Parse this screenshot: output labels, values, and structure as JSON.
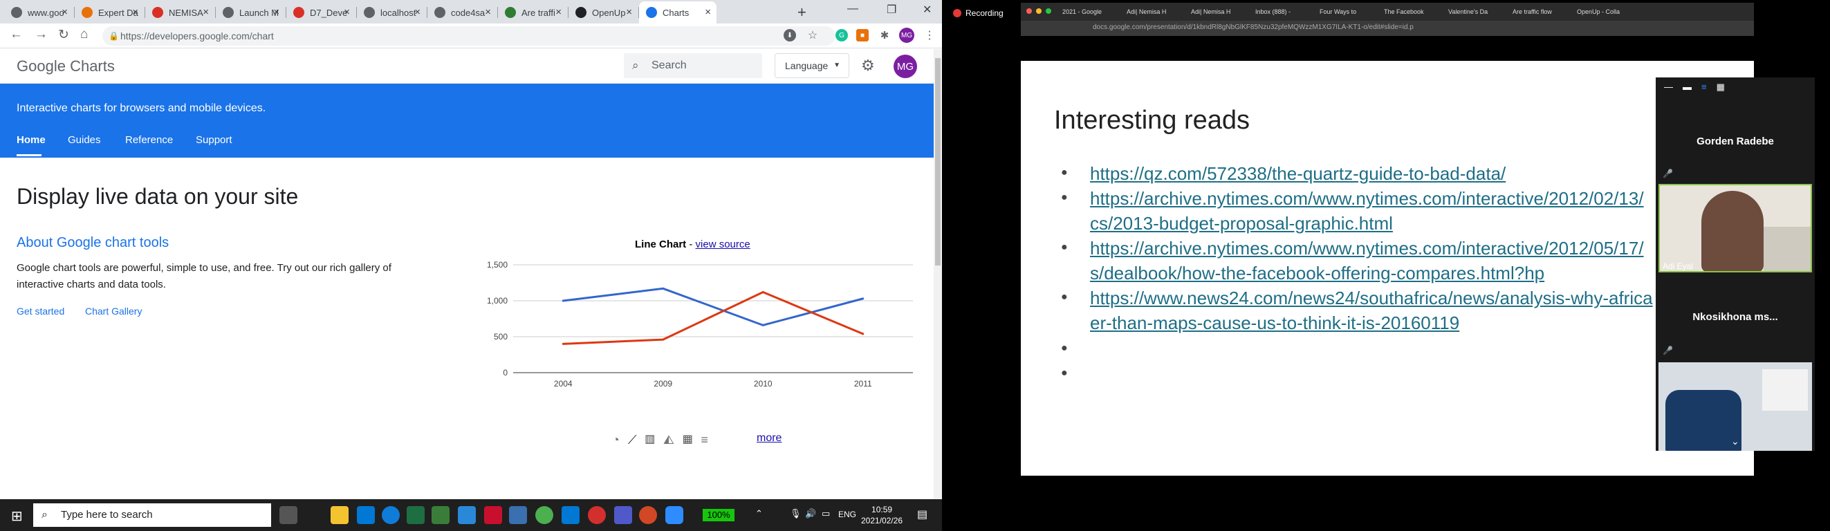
{
  "browser": {
    "tabs": [
      {
        "label": "www.goo",
        "icon": "globe-icon"
      },
      {
        "label": "Expert Da",
        "icon": "expert-icon"
      },
      {
        "label": "NEMISA",
        "icon": "gmail-icon"
      },
      {
        "label": "Launch M",
        "icon": "globe-icon"
      },
      {
        "label": "D7_Deve",
        "icon": "opera-icon"
      },
      {
        "label": "localhost",
        "icon": "globe-icon"
      },
      {
        "label": "code4sa",
        "icon": "globe-icon"
      },
      {
        "label": "Are traffi",
        "icon": "africa-icon"
      },
      {
        "label": "OpenUp",
        "icon": "openup-icon"
      },
      {
        "label": "Charts",
        "icon": "code-icon"
      }
    ],
    "url": "https://developers.google.com/chart",
    "avatar": "MG"
  },
  "site": {
    "logo_google": "Google",
    "logo_product": "Charts",
    "search_placeholder": "Search",
    "language_label": "Language",
    "avatar": "MG",
    "tagline": "Interactive charts for browsers and mobile devices.",
    "nav": [
      "Home",
      "Guides",
      "Reference",
      "Support"
    ],
    "headline": "Display live data on your site",
    "about_title": "About Google chart tools",
    "about_text": "Google chart tools are powerful, simple to use, and free. Try out our rich gallery of interactive charts and data tools.",
    "links": [
      "Get started",
      "Chart Gallery"
    ],
    "chart_title": "Line Chart",
    "chart_dash": " - ",
    "chart_link": "view source",
    "more": "more"
  },
  "chart_data": {
    "type": "line",
    "title": "Line Chart",
    "categories": [
      "2004",
      "2009",
      "2010",
      "2011"
    ],
    "series": [
      {
        "values": [
          1000,
          1170,
          660,
          1030
        ],
        "color": "#3366cc"
      },
      {
        "values": [
          400,
          460,
          1120,
          540
        ],
        "color": "#dc3912"
      }
    ],
    "ylim": [
      0,
      1500
    ],
    "yticks": [
      "0",
      "500",
      "1,000",
      "1,500"
    ],
    "grid": true
  },
  "taskbar": {
    "search_placeholder": "Type here to search",
    "battery": "100%",
    "lang": "ENG",
    "time": "10:59",
    "date": "2021/02/26"
  },
  "zoom": {
    "recording": "Recording",
    "slide_tabs": [
      "2021 - Google",
      "Adi| Nemisa H",
      "Adi| Nemisa H",
      "Inbox (888) -",
      "Four Ways to",
      "The Facebook",
      "Valentine's Da",
      "Are traffic flow",
      "OpenUp - Colla"
    ],
    "slide_url": "docs.google.com/presentation/d/1kbndRl8gNbGlKF85Nzu32pfeMQWzzM1XG7ILA-KT1-o/edit#slide=id.p",
    "slide_title": "Interesting reads",
    "slide_links": [
      [
        "https://qz.com/572338/the-quartz-guide-to-bad-data/"
      ],
      [
        "https://archive.nytimes.com/www.nytimes.com/interactive/2012/02/13/",
        "cs/2013-budget-proposal-graphic.html"
      ],
      [
        "https://archive.nytimes.com/www.nytimes.com/interactive/2012/05/17/",
        "s/dealbook/how-the-facebook-offering-compares.html?hp"
      ],
      [
        "https://www.news24.com/news24/southafrica/news/analysis-why-africa",
        "er-than-maps-cause-us-to-think-it-is-20160119"
      ]
    ],
    "participants": [
      {
        "name": "Gorden Radebe"
      },
      {
        "name": "Adi Eyal",
        "label": "Adi Eyal"
      },
      {
        "name": "Nkosikhona  ms..."
      }
    ]
  }
}
